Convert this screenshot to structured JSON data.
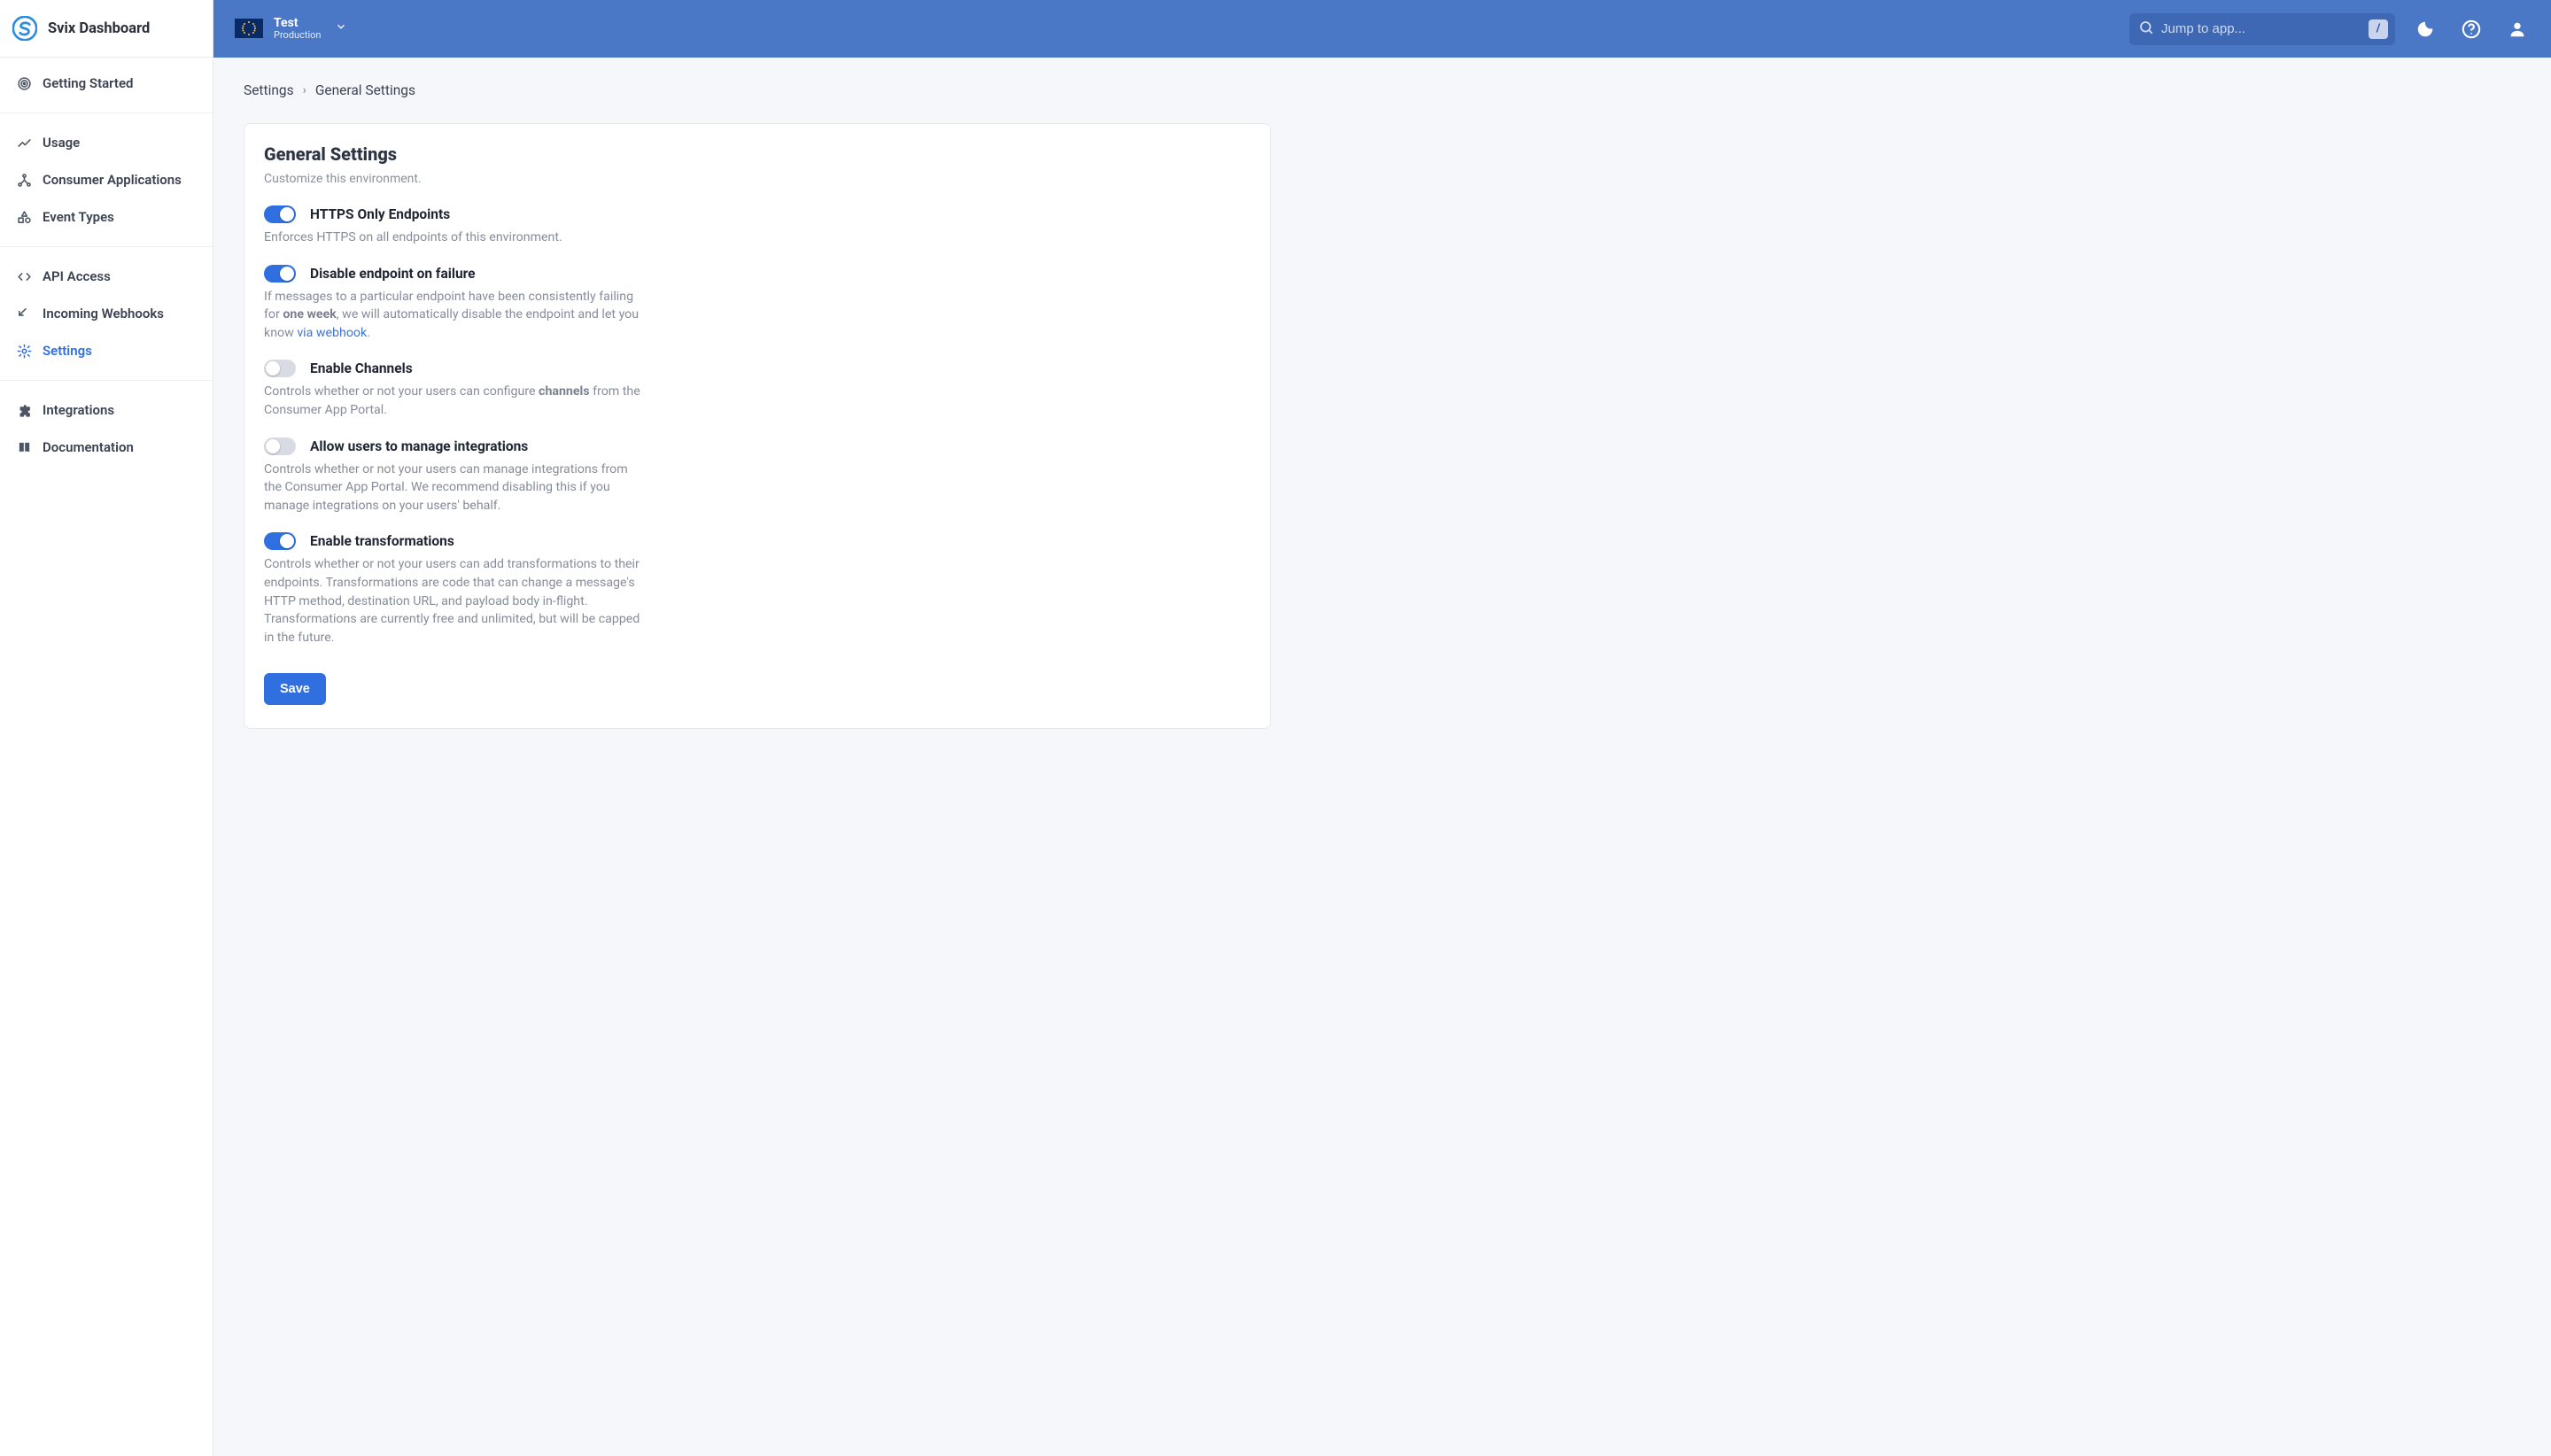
{
  "brand": {
    "title": "Svix Dashboard"
  },
  "sidebar": {
    "items": [
      {
        "label": "Getting Started",
        "name": "getting-started",
        "icon": "target-icon"
      },
      {
        "label": "Usage",
        "name": "usage",
        "icon": "chart-icon"
      },
      {
        "label": "Consumer Applications",
        "name": "consumer-applications",
        "icon": "network-icon"
      },
      {
        "label": "Event Types",
        "name": "event-types",
        "icon": "shapes-icon"
      },
      {
        "label": "API Access",
        "name": "api-access",
        "icon": "code-icon"
      },
      {
        "label": "Incoming Webhooks",
        "name": "incoming-webhooks",
        "icon": "arrow-in-icon"
      },
      {
        "label": "Settings",
        "name": "settings",
        "icon": "gear-icon",
        "active": true
      },
      {
        "label": "Integrations",
        "name": "integrations",
        "icon": "puzzle-icon"
      },
      {
        "label": "Documentation",
        "name": "documentation",
        "icon": "book-icon"
      }
    ]
  },
  "topbar": {
    "env": {
      "name": "Test",
      "sub": "Production"
    },
    "search": {
      "placeholder": "Jump to app...",
      "kbd": "/"
    }
  },
  "breadcrumb": {
    "root": "Settings",
    "current": "General Settings"
  },
  "page": {
    "title": "General Settings",
    "subtitle": "Customize this environment.",
    "save_label": "Save",
    "settings": [
      {
        "key": "https_only",
        "title": "HTTPS Only Endpoints",
        "on": true,
        "desc_html": "Enforces HTTPS on all endpoints of this environment."
      },
      {
        "key": "disable_on_failure",
        "title": "Disable endpoint on failure",
        "on": true,
        "desc_html": "If messages to a particular endpoint have been consistently failing for <b>one week</b>, we will automatically disable the endpoint and let you know <a href='#'>via webhook</a>."
      },
      {
        "key": "enable_channels",
        "title": "Enable Channels",
        "on": false,
        "desc_html": "Controls whether or not your users can configure <b>channels</b> from the Consumer App Portal."
      },
      {
        "key": "allow_integrations",
        "title": "Allow users to manage integrations",
        "on": false,
        "desc_html": "Controls whether or not your users can manage integrations from the Consumer App Portal. We recommend disabling this if you manage integrations on your users' behalf."
      },
      {
        "key": "enable_transformations",
        "title": "Enable transformations",
        "on": true,
        "desc_html": "Controls whether or not your users can add transformations to their endpoints. Transformations are code that can change a message's HTTP method, destination URL, and payload body in-flight. Transformations are currently free and unlimited, but will be capped in the future."
      }
    ]
  }
}
